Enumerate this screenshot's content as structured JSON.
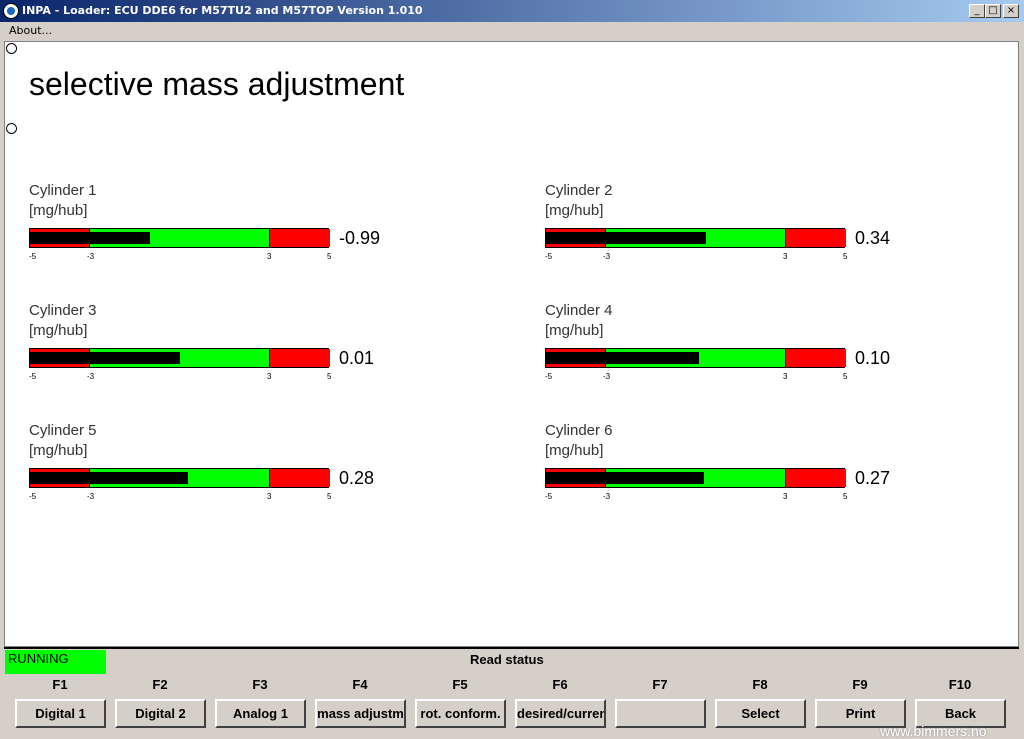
{
  "window": {
    "title": "INPA - Loader:  ECU DDE6 for M57TU2 and M57TOP Version 1.010"
  },
  "menu": {
    "about": "About..."
  },
  "window_controls": {
    "minimize": "_",
    "maximize": "□",
    "close": "×"
  },
  "page": {
    "title": "selective mass adjustment"
  },
  "gauge_scale": {
    "min": -5,
    "max": 5,
    "ticks": [
      "-5",
      "-3",
      "3",
      "5"
    ],
    "limits": [
      -5,
      -3,
      3,
      5
    ]
  },
  "colors": {
    "ok": "#00ff00",
    "out_of_range": "#ff0000",
    "bar": "#000000",
    "running": "#00ff00"
  },
  "cylinders": [
    {
      "name": "Cylinder 1",
      "unit": "[mg/hub]",
      "value": "-0.99",
      "num": -0.99
    },
    {
      "name": "Cylinder 2",
      "unit": "[mg/hub]",
      "value": "0.34",
      "num": 0.34
    },
    {
      "name": "Cylinder 3",
      "unit": "[mg/hub]",
      "value": "0.01",
      "num": 0.01
    },
    {
      "name": "Cylinder 4",
      "unit": "[mg/hub]",
      "value": "0.10",
      "num": 0.1
    },
    {
      "name": "Cylinder 5",
      "unit": "[mg/hub]",
      "value": "0.28",
      "num": 0.28
    },
    {
      "name": "Cylinder 6",
      "unit": "[mg/hub]",
      "value": "0.27",
      "num": 0.27
    }
  ],
  "status": {
    "running": "RUNNING",
    "read_status": "Read status"
  },
  "function_keys": [
    {
      "key": "F1",
      "label": "Digital 1"
    },
    {
      "key": "F2",
      "label": "Digital 2"
    },
    {
      "key": "F3",
      "label": "Analog 1"
    },
    {
      "key": "F4",
      "label": "mass adjustm"
    },
    {
      "key": "F5",
      "label": "rot. conform."
    },
    {
      "key": "F6",
      "label": "desired/curren"
    },
    {
      "key": "F7",
      "label": ""
    },
    {
      "key": "F8",
      "label": "Select"
    },
    {
      "key": "F9",
      "label": "Print"
    },
    {
      "key": "F10",
      "label": "Back"
    }
  ],
  "watermark": "www.bimmers.no"
}
